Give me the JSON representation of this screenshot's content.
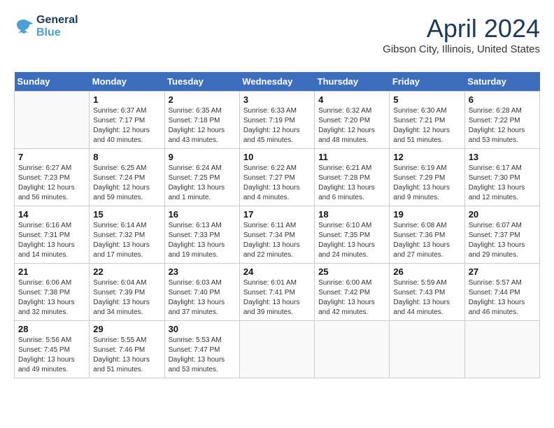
{
  "header": {
    "logo_line1": "General",
    "logo_line2": "Blue",
    "month_year": "April 2024",
    "location": "Gibson City, Illinois, United States"
  },
  "weekdays": [
    "Sunday",
    "Monday",
    "Tuesday",
    "Wednesday",
    "Thursday",
    "Friday",
    "Saturday"
  ],
  "weeks": [
    [
      {
        "day": null
      },
      {
        "day": 1,
        "sunrise": "6:37 AM",
        "sunset": "7:17 PM",
        "daylight": "12 hours and 40 minutes."
      },
      {
        "day": 2,
        "sunrise": "6:35 AM",
        "sunset": "7:18 PM",
        "daylight": "12 hours and 43 minutes."
      },
      {
        "day": 3,
        "sunrise": "6:33 AM",
        "sunset": "7:19 PM",
        "daylight": "12 hours and 45 minutes."
      },
      {
        "day": 4,
        "sunrise": "6:32 AM",
        "sunset": "7:20 PM",
        "daylight": "12 hours and 48 minutes."
      },
      {
        "day": 5,
        "sunrise": "6:30 AM",
        "sunset": "7:21 PM",
        "daylight": "12 hours and 51 minutes."
      },
      {
        "day": 6,
        "sunrise": "6:28 AM",
        "sunset": "7:22 PM",
        "daylight": "12 hours and 53 minutes."
      }
    ],
    [
      {
        "day": 7,
        "sunrise": "6:27 AM",
        "sunset": "7:23 PM",
        "daylight": "12 hours and 56 minutes."
      },
      {
        "day": 8,
        "sunrise": "6:25 AM",
        "sunset": "7:24 PM",
        "daylight": "12 hours and 59 minutes."
      },
      {
        "day": 9,
        "sunrise": "6:24 AM",
        "sunset": "7:25 PM",
        "daylight": "13 hours and 1 minute."
      },
      {
        "day": 10,
        "sunrise": "6:22 AM",
        "sunset": "7:27 PM",
        "daylight": "13 hours and 4 minutes."
      },
      {
        "day": 11,
        "sunrise": "6:21 AM",
        "sunset": "7:28 PM",
        "daylight": "13 hours and 6 minutes."
      },
      {
        "day": 12,
        "sunrise": "6:19 AM",
        "sunset": "7:29 PM",
        "daylight": "13 hours and 9 minutes."
      },
      {
        "day": 13,
        "sunrise": "6:17 AM",
        "sunset": "7:30 PM",
        "daylight": "13 hours and 12 minutes."
      }
    ],
    [
      {
        "day": 14,
        "sunrise": "6:16 AM",
        "sunset": "7:31 PM",
        "daylight": "13 hours and 14 minutes."
      },
      {
        "day": 15,
        "sunrise": "6:14 AM",
        "sunset": "7:32 PM",
        "daylight": "13 hours and 17 minutes."
      },
      {
        "day": 16,
        "sunrise": "6:13 AM",
        "sunset": "7:33 PM",
        "daylight": "13 hours and 19 minutes."
      },
      {
        "day": 17,
        "sunrise": "6:11 AM",
        "sunset": "7:34 PM",
        "daylight": "13 hours and 22 minutes."
      },
      {
        "day": 18,
        "sunrise": "6:10 AM",
        "sunset": "7:35 PM",
        "daylight": "13 hours and 24 minutes."
      },
      {
        "day": 19,
        "sunrise": "6:08 AM",
        "sunset": "7:36 PM",
        "daylight": "13 hours and 27 minutes."
      },
      {
        "day": 20,
        "sunrise": "6:07 AM",
        "sunset": "7:37 PM",
        "daylight": "13 hours and 29 minutes."
      }
    ],
    [
      {
        "day": 21,
        "sunrise": "6:06 AM",
        "sunset": "7:38 PM",
        "daylight": "13 hours and 32 minutes."
      },
      {
        "day": 22,
        "sunrise": "6:04 AM",
        "sunset": "7:39 PM",
        "daylight": "13 hours and 34 minutes."
      },
      {
        "day": 23,
        "sunrise": "6:03 AM",
        "sunset": "7:40 PM",
        "daylight": "13 hours and 37 minutes."
      },
      {
        "day": 24,
        "sunrise": "6:01 AM",
        "sunset": "7:41 PM",
        "daylight": "13 hours and 39 minutes."
      },
      {
        "day": 25,
        "sunrise": "6:00 AM",
        "sunset": "7:42 PM",
        "daylight": "13 hours and 42 minutes."
      },
      {
        "day": 26,
        "sunrise": "5:59 AM",
        "sunset": "7:43 PM",
        "daylight": "13 hours and 44 minutes."
      },
      {
        "day": 27,
        "sunrise": "5:57 AM",
        "sunset": "7:44 PM",
        "daylight": "13 hours and 46 minutes."
      }
    ],
    [
      {
        "day": 28,
        "sunrise": "5:56 AM",
        "sunset": "7:45 PM",
        "daylight": "13 hours and 49 minutes."
      },
      {
        "day": 29,
        "sunrise": "5:55 AM",
        "sunset": "7:46 PM",
        "daylight": "13 hours and 51 minutes."
      },
      {
        "day": 30,
        "sunrise": "5:53 AM",
        "sunset": "7:47 PM",
        "daylight": "13 hours and 53 minutes."
      },
      {
        "day": null
      },
      {
        "day": null
      },
      {
        "day": null
      },
      {
        "day": null
      }
    ]
  ],
  "labels": {
    "sunrise": "Sunrise:",
    "sunset": "Sunset:",
    "daylight": "Daylight:"
  }
}
